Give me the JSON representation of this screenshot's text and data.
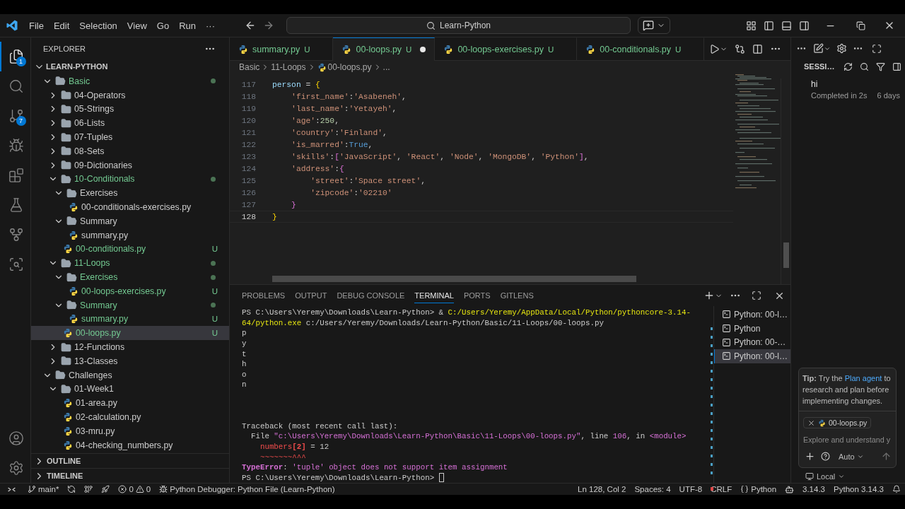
{
  "menu": [
    "File",
    "Edit",
    "Selection",
    "View",
    "Go",
    "Run",
    "···"
  ],
  "search": {
    "value": "Learn-Python"
  },
  "activity_bar": [
    {
      "kind": "explorer",
      "selected": true,
      "badge": "1"
    },
    {
      "kind": "search",
      "selected": false
    },
    {
      "kind": "source-control",
      "selected": false,
      "badge": "7"
    },
    {
      "kind": "run",
      "selected": false
    },
    {
      "kind": "extensions",
      "selected": false
    },
    {
      "kind": "testing",
      "selected": false
    },
    {
      "kind": "gitlens",
      "selected": false
    },
    {
      "kind": "inspect",
      "selected": false
    }
  ],
  "explorer": {
    "title": "EXPLORER",
    "root": "LEARN-PYTHON",
    "tree": [
      {
        "label": "Basic",
        "kind": "folder",
        "expanded": true,
        "untracked": true,
        "dot": true,
        "selected": false,
        "children": [
          {
            "label": "04-Operators",
            "kind": "folder",
            "expanded": false,
            "untracked": false,
            "dot": false,
            "selected": false
          },
          {
            "label": "05-Strings",
            "kind": "folder",
            "expanded": false,
            "untracked": false,
            "dot": false,
            "selected": false
          },
          {
            "label": "06-Lists",
            "kind": "folder",
            "expanded": false,
            "untracked": false,
            "dot": false,
            "selected": false
          },
          {
            "label": "07-Tuples",
            "kind": "folder",
            "expanded": false,
            "untracked": false,
            "dot": false,
            "selected": false
          },
          {
            "label": "08-Sets",
            "kind": "folder",
            "expanded": false,
            "untracked": false,
            "dot": false,
            "selected": false
          },
          {
            "label": "09-Dictionaries",
            "kind": "folder",
            "expanded": false,
            "untracked": false,
            "dot": false,
            "selected": false
          },
          {
            "label": "10-Conditionals",
            "kind": "folder",
            "expanded": true,
            "untracked": true,
            "dot": true,
            "selected": false,
            "children": [
              {
                "label": "Exercises",
                "kind": "folder",
                "expanded": true,
                "untracked": false,
                "dot": false,
                "selected": false,
                "children": [
                  {
                    "label": "00-conditionals-exercises.py",
                    "kind": "file",
                    "untracked": false,
                    "dot": false,
                    "selected": false
                  }
                ]
              },
              {
                "label": "Summary",
                "kind": "folder",
                "expanded": true,
                "untracked": false,
                "dot": false,
                "selected": false,
                "children": [
                  {
                    "label": "summary.py",
                    "kind": "file",
                    "untracked": false,
                    "dot": false,
                    "selected": false
                  }
                ]
              },
              {
                "label": "00-conditionals.py",
                "kind": "file",
                "untracked": true,
                "dot": false,
                "badge": "U",
                "selected": false
              }
            ]
          },
          {
            "label": "11-Loops",
            "kind": "folder",
            "expanded": true,
            "untracked": true,
            "dot": true,
            "selected": false,
            "children": [
              {
                "label": "Exercises",
                "kind": "folder",
                "expanded": true,
                "untracked": true,
                "dot": true,
                "selected": false,
                "children": [
                  {
                    "label": "00-loops-exercises.py",
                    "kind": "file",
                    "untracked": true,
                    "dot": false,
                    "badge": "U",
                    "selected": false
                  }
                ]
              },
              {
                "label": "Summary",
                "kind": "folder",
                "expanded": true,
                "untracked": true,
                "dot": true,
                "selected": false,
                "children": [
                  {
                    "label": "summary.py",
                    "kind": "file",
                    "untracked": true,
                    "dot": false,
                    "badge": "U",
                    "selected": false
                  }
                ]
              },
              {
                "label": "00-loops.py",
                "kind": "file",
                "untracked": true,
                "dot": false,
                "badge": "U",
                "selected": true
              }
            ]
          },
          {
            "label": "12-Functions",
            "kind": "folder",
            "expanded": false,
            "untracked": false,
            "dot": false,
            "selected": false
          },
          {
            "label": "13-Classes",
            "kind": "folder",
            "expanded": false,
            "untracked": false,
            "dot": false,
            "selected": false
          }
        ]
      },
      {
        "label": "Challenges",
        "kind": "folder",
        "expanded": true,
        "untracked": false,
        "dot": false,
        "selected": false,
        "children": [
          {
            "label": "01-Week1",
            "kind": "folder",
            "expanded": true,
            "untracked": false,
            "dot": false,
            "selected": false,
            "children": [
              {
                "label": "01-area.py",
                "kind": "file",
                "untracked": false,
                "dot": false,
                "selected": false
              },
              {
                "label": "02-calculation.py",
                "kind": "file",
                "untracked": false,
                "dot": false,
                "selected": false
              },
              {
                "label": "03-mru.py",
                "kind": "file",
                "untracked": false,
                "dot": false,
                "selected": false
              },
              {
                "label": "04-checking_numbers.py",
                "kind": "file",
                "untracked": false,
                "dot": false,
                "selected": false
              }
            ]
          }
        ]
      }
    ],
    "sections": [
      {
        "label": "OUTLINE",
        "expanded": false
      },
      {
        "label": "TIMELINE",
        "expanded": false
      }
    ]
  },
  "tabs": [
    {
      "label": "summary.py",
      "badge": "U",
      "selected": false,
      "dirty": false
    },
    {
      "label": "00-loops.py",
      "badge": "U",
      "selected": true,
      "dirty": true
    },
    {
      "label": "00-loops-exercises.py",
      "badge": "U",
      "selected": false,
      "dirty": false
    },
    {
      "label": "00-conditionals.py",
      "badge": "U",
      "selected": false,
      "dirty": false
    }
  ],
  "breadcrumb": [
    {
      "kind": "folder",
      "label": "Basic"
    },
    {
      "kind": "folder",
      "label": "11-Loops"
    },
    {
      "kind": "file",
      "label": "00-loops.py"
    },
    {
      "kind": "more",
      "label": "..."
    }
  ],
  "code": [
    {
      "number": "117",
      "current": false,
      "tokens": [
        {
          "kind": "var",
          "text": "person"
        },
        {
          "kind": "punct",
          "text": " = "
        },
        {
          "kind": "b1",
          "text": "{"
        }
      ]
    },
    {
      "number": "118",
      "current": false,
      "tokens": [
        {
          "kind": "str",
          "text": "    'first_name'"
        },
        {
          "kind": "punct",
          "text": ":"
        },
        {
          "kind": "str",
          "text": "'Asabeneh'"
        },
        {
          "kind": "punct",
          "text": ","
        }
      ]
    },
    {
      "number": "119",
      "current": false,
      "tokens": [
        {
          "kind": "str",
          "text": "    'last_name'"
        },
        {
          "kind": "punct",
          "text": ":"
        },
        {
          "kind": "str",
          "text": "'Yetayeh'"
        },
        {
          "kind": "punct",
          "text": ","
        }
      ]
    },
    {
      "number": "120",
      "current": false,
      "tokens": [
        {
          "kind": "str",
          "text": "    'age'"
        },
        {
          "kind": "punct",
          "text": ":"
        },
        {
          "kind": "num",
          "text": "250"
        },
        {
          "kind": "punct",
          "text": ","
        }
      ]
    },
    {
      "number": "121",
      "current": false,
      "tokens": [
        {
          "kind": "str",
          "text": "    'country'"
        },
        {
          "kind": "punct",
          "text": ":"
        },
        {
          "kind": "str",
          "text": "'Finland'"
        },
        {
          "kind": "punct",
          "text": ","
        }
      ]
    },
    {
      "number": "122",
      "current": false,
      "tokens": [
        {
          "kind": "str",
          "text": "    'is_marred'"
        },
        {
          "kind": "punct",
          "text": ":"
        },
        {
          "kind": "kw",
          "text": "True"
        },
        {
          "kind": "punct",
          "text": ","
        }
      ]
    },
    {
      "number": "123",
      "current": false,
      "tokens": [
        {
          "kind": "str",
          "text": "    'skills'"
        },
        {
          "kind": "punct",
          "text": ":"
        },
        {
          "kind": "b2",
          "text": "["
        },
        {
          "kind": "str",
          "text": "'JavaScript'"
        },
        {
          "kind": "punct",
          "text": ", "
        },
        {
          "kind": "str",
          "text": "'React'"
        },
        {
          "kind": "punct",
          "text": ", "
        },
        {
          "kind": "str",
          "text": "'Node'"
        },
        {
          "kind": "punct",
          "text": ", "
        },
        {
          "kind": "str",
          "text": "'MongoDB'"
        },
        {
          "kind": "punct",
          "text": ", "
        },
        {
          "kind": "str",
          "text": "'Python'"
        },
        {
          "kind": "b2",
          "text": "]"
        },
        {
          "kind": "punct",
          "text": ","
        }
      ]
    },
    {
      "number": "124",
      "current": false,
      "tokens": [
        {
          "kind": "str",
          "text": "    'address'"
        },
        {
          "kind": "punct",
          "text": ":"
        },
        {
          "kind": "b2",
          "text": "{"
        }
      ]
    },
    {
      "number": "125",
      "current": false,
      "tokens": [
        {
          "kind": "str",
          "text": "        'street'"
        },
        {
          "kind": "punct",
          "text": ":"
        },
        {
          "kind": "str",
          "text": "'Space street'"
        },
        {
          "kind": "punct",
          "text": ","
        }
      ]
    },
    {
      "number": "126",
      "current": false,
      "tokens": [
        {
          "kind": "str",
          "text": "        'zipcode'"
        },
        {
          "kind": "punct",
          "text": ":"
        },
        {
          "kind": "str",
          "text": "'02210'"
        }
      ]
    },
    {
      "number": "127",
      "current": false,
      "tokens": [
        {
          "kind": "b2",
          "text": "    }"
        }
      ]
    },
    {
      "number": "128",
      "current": true,
      "tokens": [
        {
          "kind": "b1",
          "text": "}"
        }
      ]
    }
  ],
  "panel": {
    "tabs": [
      {
        "label": "PROBLEMS",
        "selected": false
      },
      {
        "label": "OUTPUT",
        "selected": false
      },
      {
        "label": "DEBUG CONSOLE",
        "selected": false
      },
      {
        "label": "TERMINAL",
        "selected": true
      },
      {
        "label": "PORTS",
        "selected": false
      },
      {
        "label": "GITLENS",
        "selected": false
      }
    ],
    "terminal": [
      {
        "kind": "text",
        "segments": [
          {
            "kind": "plain",
            "text": "PS C:\\Users\\Yeremy\\Downloads\\Learn-Python> & "
          },
          {
            "kind": "path",
            "text": "C:/Users/Yeremy/AppData/Local/Python/pythoncore-3.14-"
          }
        ]
      },
      {
        "kind": "text",
        "segments": [
          {
            "kind": "path",
            "text": "64/python.exe"
          },
          {
            "kind": "plain",
            "text": " c:/Users/Yeremy/Downloads/Learn-Python/Basic/11-Loops/00-loops.py"
          }
        ]
      },
      {
        "kind": "text",
        "segments": [
          {
            "kind": "plain",
            "text": "p"
          }
        ]
      },
      {
        "kind": "text",
        "segments": [
          {
            "kind": "plain",
            "text": "y"
          }
        ]
      },
      {
        "kind": "text",
        "segments": [
          {
            "kind": "plain",
            "text": "t"
          }
        ]
      },
      {
        "kind": "text",
        "segments": [
          {
            "kind": "plain",
            "text": "h"
          }
        ]
      },
      {
        "kind": "text",
        "segments": [
          {
            "kind": "plain",
            "text": "o"
          }
        ]
      },
      {
        "kind": "text",
        "segments": [
          {
            "kind": "plain",
            "text": "n"
          }
        ]
      },
      {
        "kind": "blank"
      },
      {
        "kind": "blank"
      },
      {
        "kind": "blank"
      },
      {
        "kind": "text",
        "segments": [
          {
            "kind": "plain",
            "text": "Traceback (most recent call last):"
          }
        ]
      },
      {
        "kind": "text",
        "segments": [
          {
            "kind": "plain",
            "text": "  File "
          },
          {
            "kind": "magenta",
            "text": "\"c:\\Users\\Yeremy\\Downloads\\Learn-Python\\Basic\\11-Loops\\00-loops.py\""
          },
          {
            "kind": "plain",
            "text": ", line "
          },
          {
            "kind": "magenta",
            "text": "106"
          },
          {
            "kind": "plain",
            "text": ", in "
          },
          {
            "kind": "magenta",
            "text": "<module>"
          }
        ]
      },
      {
        "kind": "text",
        "segments": [
          {
            "kind": "red",
            "text": "    numbers"
          },
          {
            "kind": "redbold",
            "text": "[2]"
          },
          {
            "kind": "plain",
            "text": " = 12"
          }
        ]
      },
      {
        "kind": "text",
        "segments": [
          {
            "kind": "red",
            "text": "    ~~~~~~~^^^"
          }
        ]
      },
      {
        "kind": "text",
        "segments": [
          {
            "kind": "errbold",
            "text": "TypeError"
          },
          {
            "kind": "plain",
            "text": ": "
          },
          {
            "kind": "magenta",
            "text": "'tuple' object does not support item assignment"
          }
        ]
      },
      {
        "kind": "prompt",
        "segments": [
          {
            "kind": "plain",
            "text": "PS C:\\Users\\Yeremy\\Downloads\\Learn-Python> "
          }
        ]
      }
    ],
    "terminals": [
      {
        "label": "Python: 00-l…",
        "selected": false
      },
      {
        "label": "Python",
        "selected": false
      },
      {
        "label": "Python: 00-…",
        "selected": false
      },
      {
        "label": "Python: 00-l…",
        "selected": true
      }
    ]
  },
  "chat": {
    "header": "SESSI…",
    "sessions": [
      {
        "title": "hi",
        "status": "Completed in 2s",
        "age": "6 days"
      }
    ],
    "tip": {
      "lead": "**Tip:** Try the",
      "link": "Plan agent",
      "rest": "to research and plan before implementing changes."
    },
    "context_file": "00-loops.py",
    "placeholder": "Explore and understand y",
    "mode": "Auto",
    "location": "Local"
  },
  "status_bar": {
    "branch": "main*",
    "errors": "0",
    "warnings": "0",
    "debug": "Python Debugger: Python File (Learn-Python)",
    "items": [
      "Ln 128, Col 2",
      "Spaces: 4",
      "UTF-8",
      "CRLF"
    ],
    "language": "Python",
    "version": "3.14.3",
    "interpreter": "Python 3.14.3"
  }
}
